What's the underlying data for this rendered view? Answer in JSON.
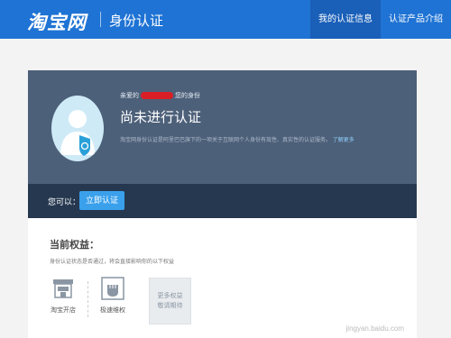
{
  "header": {
    "logo_text": "淘宝网",
    "section_title": "身份认证",
    "nav": [
      {
        "label": "我的认证信息",
        "active": true
      },
      {
        "label": "认证产品介绍",
        "active": false
      }
    ]
  },
  "hero": {
    "greeting_prefix": "亲爱的",
    "greeting_suffix": "您的身份",
    "status": "尚未进行认证",
    "description": "淘宝网身份认证是阿里巴巴旗下的一项关于互联网个人身份有效性、真实性的认证服务。",
    "learn_more": "了解更多"
  },
  "action_bar": {
    "label": "您可以：",
    "button": "立即认证"
  },
  "benefits": {
    "title": "当前权益：",
    "subtitle": "身份认证状态是否通过，将会直接影响你的以下权益",
    "items": [
      {
        "label": "淘宝开店",
        "icon": "store-icon"
      },
      {
        "label": "极速维权",
        "icon": "fist-icon"
      }
    ],
    "more_line1": "更多权益",
    "more_line2": "敬请期待"
  },
  "watermark": "jingyan.baidu.com",
  "colors": {
    "topbar": "#1f73d4",
    "hero": "#4d6079",
    "action_bar": "#263850",
    "button": "#3aa0ec"
  }
}
